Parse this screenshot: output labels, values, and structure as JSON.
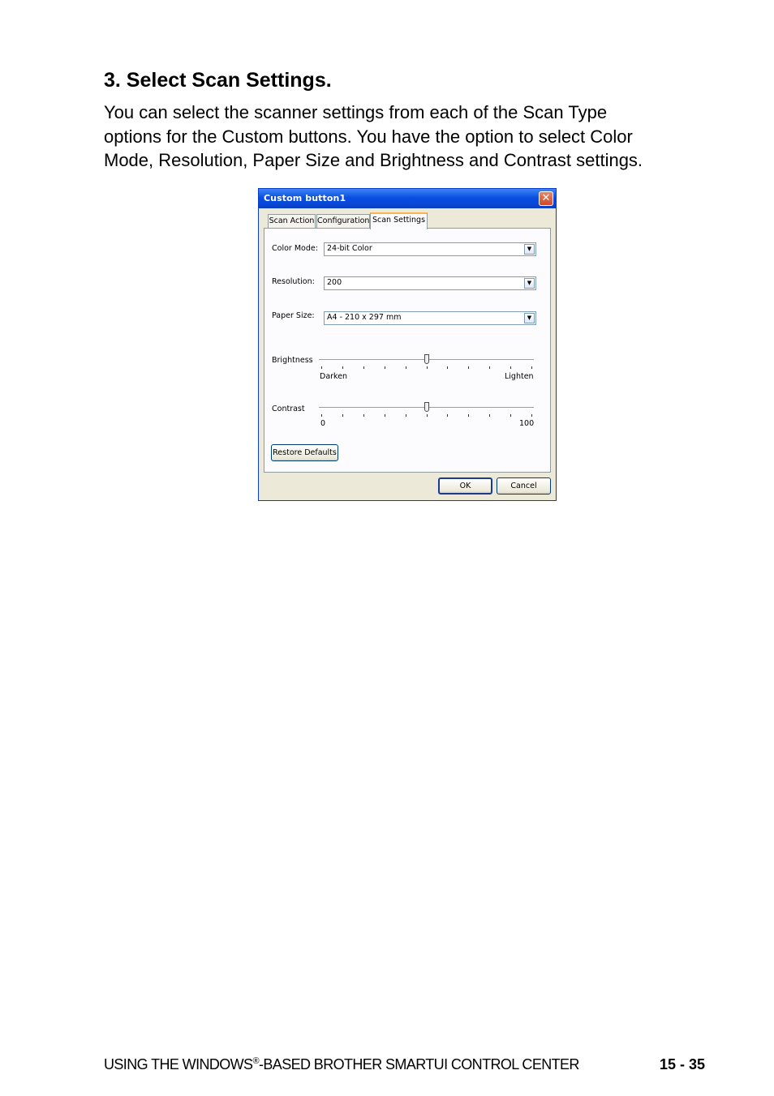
{
  "heading": "3. Select Scan Settings.",
  "body_lines": [
    "You can select the scanner settings from each of the Scan Type",
    "options for the Custom buttons. You have the option to select Color",
    "Mode, Resolution, Paper Size and Brightness and Contrast settings."
  ],
  "dialog": {
    "title": "Custom button1",
    "close_symbol": "✕",
    "tabs": [
      "Scan Action",
      "Configuration",
      "Scan Settings"
    ],
    "active_tab": "Scan Settings",
    "color_mode": {
      "label": "Color Mode:",
      "value": "24-bit Color"
    },
    "resolution": {
      "label": "Resolution:",
      "value": "200"
    },
    "paper_size": {
      "label": "Paper Size:",
      "value": "A4 - 210 x 297 mm"
    },
    "brightness": {
      "label": "Brightness",
      "min_label": "Darken",
      "max_label": "Lighten",
      "level": 0.5
    },
    "contrast": {
      "label": "Contrast",
      "min_label": "0",
      "max_label": "100",
      "level": 0.5
    },
    "restore_defaults": "Restore Defaults",
    "ok": "OK",
    "cancel": "Cancel",
    "dropdown_icon": "▼"
  },
  "footer": {
    "left_prefix": "USING THE WINDOWS",
    "registered": "®",
    "left_suffix": "-BASED BROTHER SMARTUI CONTROL CENTER",
    "page": "15 - 35"
  }
}
